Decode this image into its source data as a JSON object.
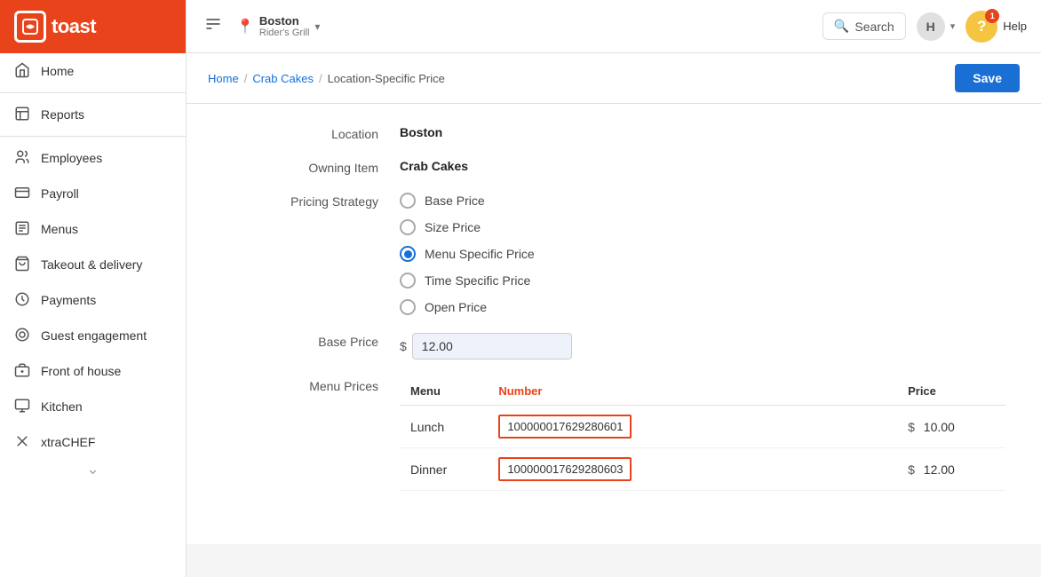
{
  "brand": {
    "name": "toast",
    "logo_char": "💬"
  },
  "topbar": {
    "toggle_icon": "☰",
    "location": {
      "city": "Boston",
      "restaurant": "Rider's Grill"
    },
    "search_label": "Search",
    "user_initial": "H",
    "help_label": "Help",
    "help_notification": "1"
  },
  "sidebar": {
    "items": [
      {
        "id": "home",
        "label": "Home",
        "icon": "home"
      },
      {
        "id": "reports",
        "label": "Reports",
        "icon": "reports"
      },
      {
        "id": "employees",
        "label": "Employees",
        "icon": "employees"
      },
      {
        "id": "payroll",
        "label": "Payroll",
        "icon": "payroll"
      },
      {
        "id": "menus",
        "label": "Menus",
        "icon": "menus"
      },
      {
        "id": "takeout",
        "label": "Takeout & delivery",
        "icon": "takeout"
      },
      {
        "id": "payments",
        "label": "Payments",
        "icon": "payments"
      },
      {
        "id": "guest",
        "label": "Guest engagement",
        "icon": "guest"
      },
      {
        "id": "frontofhouse",
        "label": "Front of house",
        "icon": "frontofhouse"
      },
      {
        "id": "kitchen",
        "label": "Kitchen",
        "icon": "kitchen"
      },
      {
        "id": "xtrachef",
        "label": "xtraCHEF",
        "icon": "xtrachef"
      }
    ]
  },
  "breadcrumb": {
    "home": "Home",
    "item": "Crab Cakes",
    "current": "Location-Specific Price"
  },
  "save_button": "Save",
  "form": {
    "location_label": "Location",
    "location_value": "Boston",
    "owning_item_label": "Owning Item",
    "owning_item_value": "Crab Cakes",
    "pricing_strategy_label": "Pricing Strategy",
    "pricing_options": [
      {
        "id": "base",
        "label": "Base Price",
        "selected": false
      },
      {
        "id": "size",
        "label": "Size Price",
        "selected": false
      },
      {
        "id": "menu_specific",
        "label": "Menu Specific Price",
        "selected": true
      },
      {
        "id": "time_specific",
        "label": "Time Specific Price",
        "selected": false
      },
      {
        "id": "open",
        "label": "Open Price",
        "selected": false
      }
    ],
    "base_price_label": "Base Price",
    "base_price_value": "12.00",
    "menu_prices_label": "Menu Prices",
    "menu_table": {
      "headers": [
        "Menu",
        "Number",
        "",
        "Price"
      ],
      "rows": [
        {
          "menu": "Lunch",
          "number": "100000017629280601",
          "currency": "$",
          "price": "10.00"
        },
        {
          "menu": "Dinner",
          "number": "100000017629280603",
          "currency": "$",
          "price": "12.00"
        }
      ]
    }
  },
  "icons": {
    "home": "⌂",
    "reports": "📊",
    "employees": "👤",
    "payroll": "💳",
    "menus": "📋",
    "takeout": "🛍",
    "payments": "💳",
    "guest": "⭕",
    "frontofhouse": "🏠",
    "kitchen": "🍳",
    "xtrachef": "✖"
  }
}
